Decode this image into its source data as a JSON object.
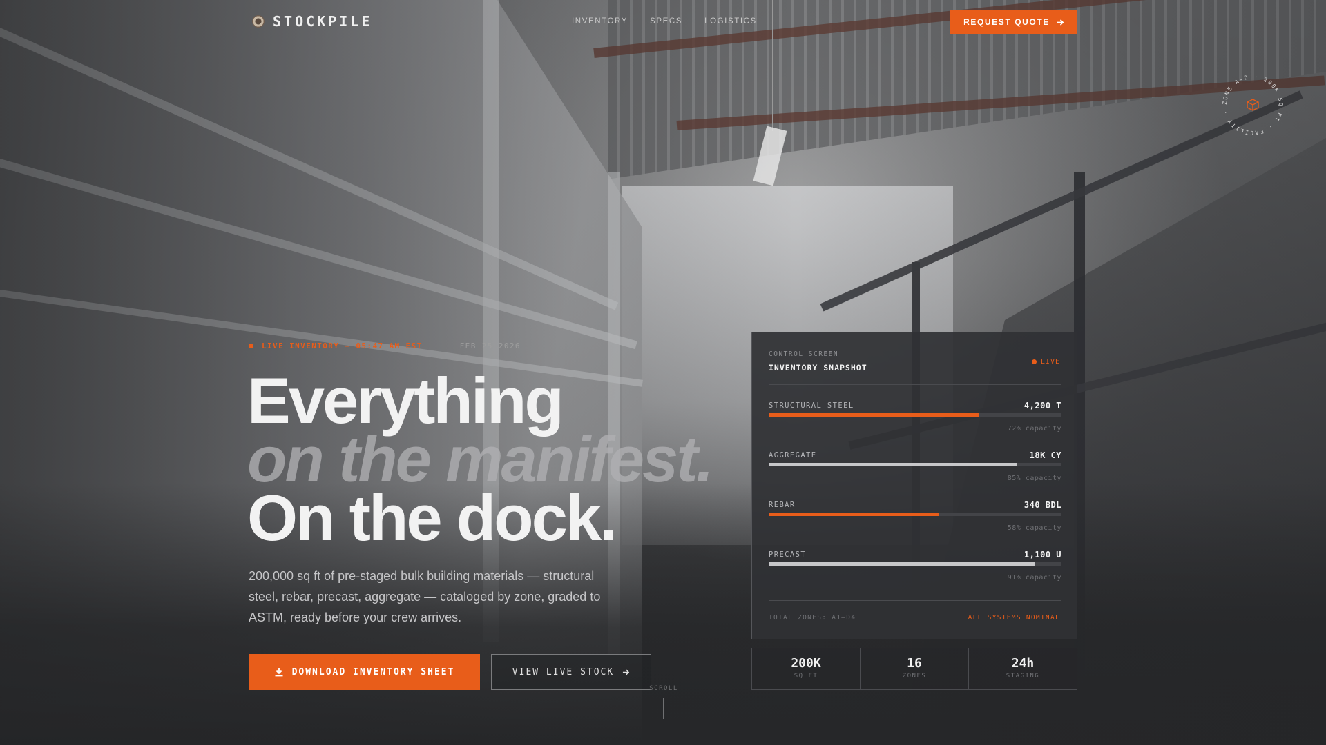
{
  "brand": {
    "name": "STOCKPILE",
    "icon": "gear-icon"
  },
  "nav": {
    "links": [
      "INVENTORY",
      "SPECS",
      "LOGISTICS"
    ],
    "cta_label": "REQUEST QUOTE"
  },
  "badge": {
    "ring_text": "ZONE A–D · 200K SQ FT · FACILITY ·",
    "icon": "box-icon"
  },
  "hero": {
    "ticker_live": "LIVE INVENTORY — 05:47 AM EST",
    "ticker_date": "FEB 25 2026",
    "headline_1": "Everything",
    "headline_2": "on the manifest.",
    "headline_3": "On the dock.",
    "lede": "200,000 sq ft of pre-staged bulk building materials — structural steel, rebar, precast, aggregate — cataloged by zone, graded to ASTM, ready before your crew arrives.",
    "primary_cta": "DOWNLOAD INVENTORY SHEET",
    "secondary_cta": "VIEW LIVE STOCK",
    "scroll_label": "SCROLL"
  },
  "panel": {
    "eyebrow": "CONTROL SCREEN",
    "title": "INVENTORY SNAPSHOT",
    "live_label": "LIVE",
    "items": [
      {
        "label": "STRUCTURAL STEEL",
        "value": "4,200 T",
        "capacity_pct": 72,
        "capacity_text": "72% capacity",
        "color": "#e85d1a"
      },
      {
        "label": "AGGREGATE",
        "value": "18K CY",
        "capacity_pct": 85,
        "capacity_text": "85% capacity",
        "color": "#c7c7c9"
      },
      {
        "label": "REBAR",
        "value": "340 BDL",
        "capacity_pct": 58,
        "capacity_text": "58% capacity",
        "color": "#e85d1a"
      },
      {
        "label": "PRECAST",
        "value": "1,100 U",
        "capacity_pct": 91,
        "capacity_text": "91% capacity",
        "color": "#c7c7c9"
      }
    ],
    "footer_left": "TOTAL ZONES: A1–D4",
    "footer_right": "ALL SYSTEMS NOMINAL"
  },
  "stats": [
    {
      "value": "200K",
      "label": "SQ FT"
    },
    {
      "value": "16",
      "label": "ZONES"
    },
    {
      "value": "24h",
      "label": "STAGING"
    }
  ],
  "colors": {
    "accent": "#e85d1a",
    "panel_bg": "#303134",
    "text": "#f2f2f2"
  }
}
